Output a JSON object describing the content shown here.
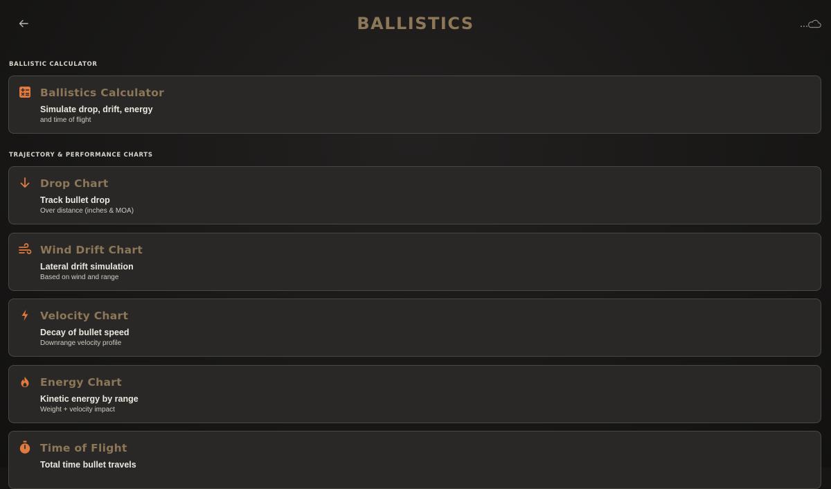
{
  "header": {
    "title": "BALLISTICS",
    "back_icon": "arrow-left-icon",
    "cloud_icon": "cloud-icon"
  },
  "colors": {
    "accent": "#e07a3e",
    "title_brown": "#8c7758",
    "card_bg": "#2a2826",
    "card_border": "#4b4843"
  },
  "sections": {
    "calculator_label": "BALLISTIC CALCULATOR",
    "charts_label": "TRAJECTORY & PERFORMANCE CHARTS"
  },
  "cards": [
    {
      "icon": "calculator-icon",
      "title": "Ballistics Calculator",
      "subtitle": "Simulate drop, drift, energy",
      "description": "and time of flight"
    },
    {
      "icon": "arrow-down-icon",
      "title": "Drop Chart",
      "subtitle": "Track bullet drop",
      "description": "Over distance (inches & MOA)"
    },
    {
      "icon": "wind-icon",
      "title": "Wind Drift Chart",
      "subtitle": "Lateral drift simulation",
      "description": "Based on wind and range"
    },
    {
      "icon": "lightning-bolt-icon",
      "title": "Velocity Chart",
      "subtitle": "Decay of bullet speed",
      "description": "Downrange velocity profile"
    },
    {
      "icon": "flame-icon",
      "title": "Energy Chart",
      "subtitle": "Kinetic energy by range",
      "description": "Weight + velocity impact"
    },
    {
      "icon": "stopwatch-icon",
      "title": "Time of Flight",
      "subtitle": "Total time bullet travels",
      "description": ""
    }
  ]
}
